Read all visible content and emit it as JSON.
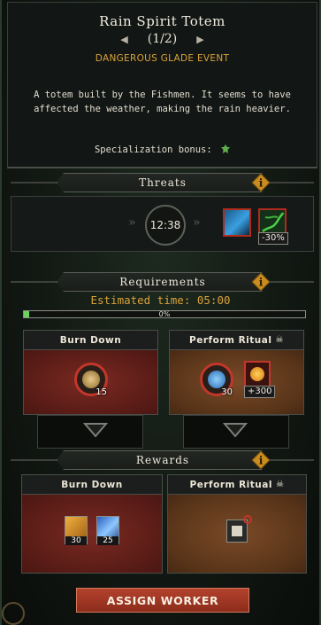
{
  "header": {
    "title": "Rain Spirit Totem",
    "pager": "(1/2)",
    "event_type": "DANGEROUS GLADE EVENT",
    "description": "A totem built by the Fishmen. It seems to have affected the weather, making the rain heavier.",
    "specialization_label": "Specialization bonus:",
    "specialization_icon": "leaf-icon"
  },
  "threats": {
    "title": "Threats",
    "timer": "12:38",
    "threat_icons": [
      "storm-icon",
      "vines-icon"
    ],
    "threat_modifier": "-30%"
  },
  "requirements": {
    "title": "Requirements",
    "estimated_time": "Estimated time: 05:00",
    "progress_label": "0%",
    "progress_value": 0.02,
    "options": [
      {
        "label": "Burn Down",
        "resource_count": "15",
        "icon": "resource-icon"
      },
      {
        "label": "Perform Ritual",
        "resource_count": "30",
        "extra_count": "+300",
        "icon": "resource-icon",
        "extra_icon": "amber-icon",
        "skull": "skull-icon"
      }
    ]
  },
  "rewards": {
    "title": "Rewards",
    "options": [
      {
        "label": "Burn Down",
        "items": [
          {
            "icon": "wood-icon",
            "count": "30"
          },
          {
            "icon": "crystal-icon",
            "count": "25"
          }
        ]
      },
      {
        "label": "Perform Ritual",
        "items": [
          {
            "icon": "relic-icon"
          }
        ],
        "skull": "skull-icon"
      }
    ]
  },
  "assign_button": "ASSIGN WORKER",
  "colors": {
    "accent_gold": "#d9a23a",
    "danger_red": "#b02a1e",
    "progress_green": "#6bd35a"
  }
}
